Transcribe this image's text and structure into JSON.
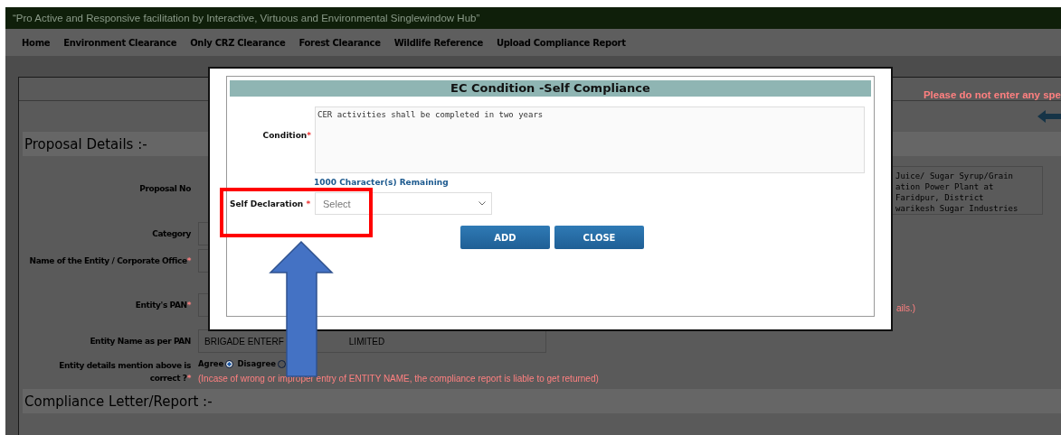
{
  "header": {
    "tagline": "“Pro Active and Responsive facilitation by Interactive, Virtuous and Environmental Singlewindow Hub”"
  },
  "nav": [
    {
      "label": "Home"
    },
    {
      "label": "Environment Clearance"
    },
    {
      "label": "Only CRZ Clearance"
    },
    {
      "label": "Forest Clearance"
    },
    {
      "label": "Wildlife Reference"
    },
    {
      "label": "Upload Compliance Report"
    }
  ],
  "notice": "Please do not enter any spe",
  "proposal_section": {
    "title": "Proposal Details :-",
    "fields": [
      {
        "kind": "textarea",
        "label": "Proposal No",
        "lines": [
          "Juice/ Sugar Syrup/Grain",
          "ation Power Plant at",
          "Faridpur, District",
          "warikesh Sugar Industries"
        ]
      },
      {
        "kind": "input",
        "label": "Category"
      },
      {
        "kind": "input",
        "label": "Name of the Entity / Corporate Office",
        "required_mark": "*"
      },
      {
        "kind": "input",
        "label": "Entity's PAN",
        "required_mark": "*",
        "note": "ails.)"
      },
      {
        "kind": "input",
        "label": "Entity Name as per PAN",
        "value_parts": [
          "BRIGADE ENTERF",
          "LIMITED"
        ]
      },
      {
        "kind": "radio",
        "label": "Entity details mention above is correct ?",
        "required_mark": "*",
        "options": [
          {
            "label": "Agree",
            "selected": true
          },
          {
            "label": "Disagree",
            "selected": false
          }
        ],
        "note": "(Incase of wrong or improper entry of ENTITY NAME, the compliance report is liable to get returned)"
      }
    ]
  },
  "compliance_section": {
    "title": "Compliance Letter/Report :-"
  },
  "modal": {
    "title": "EC Condition -Self Compliance",
    "condition_label": "Condition",
    "condition_mark": "*",
    "condition_value": "CER activities shall be completed in two years",
    "remaining": "1000 Character(s) Remaining",
    "declaration_label": "Self Declaration",
    "declaration_mark": "*",
    "declaration_placeholder": "Select",
    "buttons": [
      {
        "label": "ADD"
      },
      {
        "label": "CLOSE"
      }
    ]
  }
}
